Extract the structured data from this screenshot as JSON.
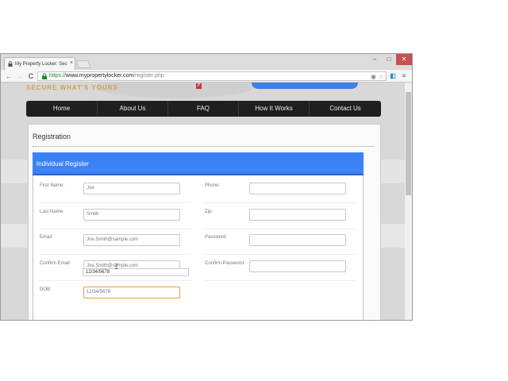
{
  "browser": {
    "tab_title": "My Property Locker: Secu",
    "tab_close": "×",
    "window_buttons": {
      "minimize": "–",
      "maximize": "□",
      "close": "✕"
    },
    "address": {
      "scheme": "https://",
      "host": "www.mypropertylocker.com",
      "path": "/register.php"
    },
    "nav": {
      "back": "←",
      "forward": "→",
      "reload": "C"
    },
    "menu": "≡"
  },
  "site": {
    "logo": "SECURE WHAT'S YOURS",
    "pinterest": "P",
    "nav_items": [
      "Home",
      "About Us",
      "FAQ",
      "How It Works",
      "Contact Us"
    ]
  },
  "form": {
    "page_title": "Registration",
    "section_title": "Individual Register",
    "left": [
      {
        "label": "First Name:",
        "value": "Joe"
      },
      {
        "label": "Last Name:",
        "value": "Smith"
      },
      {
        "label": "Email:",
        "value": "Joe.Smith@sample.com"
      },
      {
        "label": "Confirm Email:",
        "value": "Joe.Smith@sample.com"
      },
      {
        "label": "DOB:",
        "value": "12/34/5678"
      }
    ],
    "right": [
      {
        "label": "Phone:",
        "value": ""
      },
      {
        "label": "Zip:",
        "value": ""
      },
      {
        "label": "Password:",
        "value": ""
      },
      {
        "label": "Confirm Password:",
        "value": ""
      }
    ],
    "autocomplete_suggestion": "12/34/5678"
  }
}
